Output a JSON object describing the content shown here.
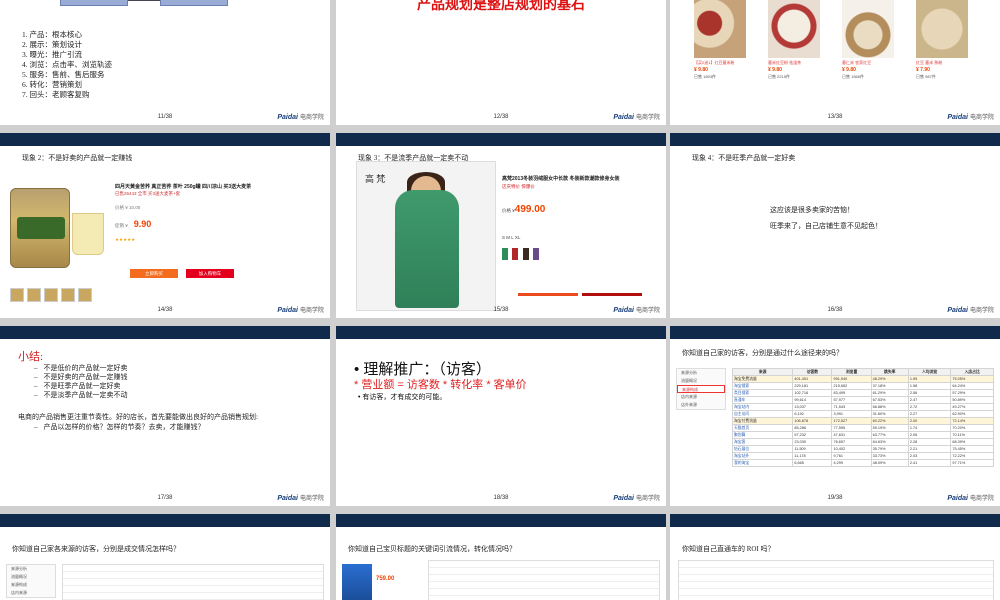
{
  "brand": {
    "logo": "Paidai",
    "logo_sub": "电商学院",
    "accent": "#0f2a4a",
    "red": "#e02020"
  },
  "slide11": {
    "page": "11/38",
    "items": [
      "1.  产品：根本核心",
      "2.  展示：策划设计",
      "3.  曝光：推广引流",
      "4.  浏览：点击率、浏览轨迹",
      "5.  服务：售前、售后服务",
      "6.  转化：营销策划",
      "7.  回头：老顾客复购"
    ]
  },
  "slide12": {
    "page": "12/38",
    "title": "产品规划是整店规划的基石"
  },
  "slide13": {
    "page": "13/38",
    "products": [
      {
        "price": "¥ 9.80",
        "cap": "【买2送1】红豆薏米粉",
        "meta": "已售 1893件"
      },
      {
        "price": "¥ 9.80",
        "cap": "薏米红豆粉 祛湿茶",
        "meta": "已售 2215件"
      },
      {
        "price": "¥ 9.80",
        "cap": "薏仁米 农家红豆",
        "meta": "已售 1566件"
      },
      {
        "price": "¥ 7.90",
        "cap": "红豆 薏米 熟粉",
        "meta": "已售 987件"
      }
    ]
  },
  "slide14": {
    "page": "14/38",
    "title": "现象 2：不是好卖的产品就一定赚钱",
    "product_title": "四月天黄金苦荞 真正苦荞 茶叶 250g罐 四川凉山 买3送大麦茶",
    "note": "已售26443 全市 买3送大麦茶+套",
    "price": "9.90",
    "buy_label": "立即购买",
    "cart_label": "加入购物车"
  },
  "slide15": {
    "page": "15/38",
    "title": "现象 3：不是流季产品就一定卖不动",
    "brand_tag": "高 梵",
    "product_title": "高梵2013冬装羽绒服女中长款 冬装新款潮款修身女装",
    "promo": "店庆特价 惊爆价",
    "price": "499.00",
    "sizes": "S  M  L  XL"
  },
  "slide16": {
    "page": "16/38",
    "title": "现象 4：不是旺季产品就一定好卖",
    "line1": "这应该是很多卖家的苦恼！",
    "line2": "旺季来了，自己店铺生意不见起色！"
  },
  "slide17": {
    "page": "17/38",
    "heading": "小结:",
    "items": [
      "不是低价的产品就一定好卖",
      "不是好卖的产品就一定赚钱",
      "不是旺季产品就一定好卖",
      "不是淡季产品就一定卖不动"
    ],
    "para": "电商的产品销售更注重节奏性。好的店长，首先要能做出良好的产品销售规划:",
    "sub": "产品以怎样的价格？怎样的节奏？去卖，才能赚钱？"
  },
  "slide18": {
    "page": "18/38",
    "bullet": "• 理解推广：（访客）",
    "formula": "* 营业额 = 访客数 * 转化率 * 客单价",
    "small": "•  有访客，才有成交的可能。"
  },
  "slide19": {
    "page": "19/38",
    "title": "你知道自己家的访客，分别是通过什么途径来的吗？",
    "menu": [
      "来源分析",
      "流量概况",
      "来源构成",
      "店内来源",
      "店外来源"
    ],
    "headers": [
      "来源",
      "访客数",
      "浏览量",
      "跳失率",
      "人均浏览",
      "入店占比"
    ],
    "rows": [
      [
        "淘宝免费流量",
        "401,451",
        "991,940",
        "48.29%",
        "1.99",
        "75.05%"
      ],
      [
        "淘宝搜索",
        "229,181",
        "215,652",
        "37.18%",
        "1.58",
        "64.24%"
      ],
      [
        "类目搜索",
        "102,716",
        "83,499",
        "61.29%",
        "2.56",
        "57.29%"
      ],
      [
        "直通车",
        "99,614",
        "57,977",
        "67.53%",
        "2.47",
        "50.89%"
      ],
      [
        "淘宝站内",
        "13,037",
        "71,543",
        "66.68%",
        "2.72",
        "49.27%"
      ],
      [
        "自主访问",
        "6,192",
        "3,991",
        "31.60%",
        "2.27",
        "62.90%"
      ],
      [
        "淘宝付费流量",
        "106,878",
        "172,527",
        "60.22%",
        "2.00",
        "72.14%"
      ],
      [
        "天猫首页",
        "85,286",
        "77,595",
        "59.19%",
        "1.74",
        "70.20%"
      ],
      [
        "聚划算",
        "57,232",
        "47,631",
        "63.77%",
        "2.06",
        "70.11%"
      ],
      [
        "淘宝客",
        "23,039",
        "76,657",
        "64.63%",
        "2.28",
        "68.39%"
      ],
      [
        "钻石展位",
        "11,509",
        "10,402",
        "35.79%",
        "2.21",
        "75.45%"
      ],
      [
        "淘宝站外",
        "11,178",
        "9,761",
        "33.73%",
        "2.03",
        "72.22%"
      ],
      [
        "我的淘宝",
        "6,665",
        "4,299",
        "48.09%",
        "2.41",
        "97.71%"
      ]
    ]
  },
  "slide20": {
    "title": "你知道自己家各来源的访客，分别是成交情况怎样吗？",
    "menu": [
      "来源分析",
      "流量概况",
      "来源构成",
      "店内来源"
    ]
  },
  "slide21": {
    "title": "你知道自己宝贝标题的关键词引流情况，转化情况吗？",
    "price": "759.00"
  },
  "slide22": {
    "title": "你知道自己直通车的 ROI 吗？"
  }
}
